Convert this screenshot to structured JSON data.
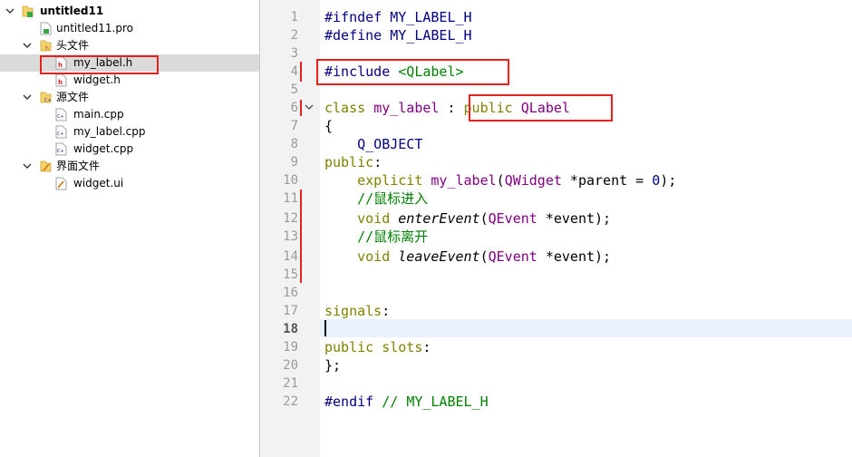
{
  "tree": {
    "project": "untitled11",
    "items": [
      {
        "label": "untitled11.pro"
      },
      {
        "label": "头文件"
      },
      {
        "label": "my_label.h"
      },
      {
        "label": "widget.h"
      },
      {
        "label": "源文件"
      },
      {
        "label": "main.cpp"
      },
      {
        "label": "my_label.cpp"
      },
      {
        "label": "widget.cpp"
      },
      {
        "label": "界面文件"
      },
      {
        "label": "widget.ui"
      }
    ]
  },
  "editor": {
    "current_line": "18",
    "line_numbers": [
      "1",
      "2",
      "3",
      "4",
      "5",
      "6",
      "7",
      "8",
      "9",
      "10",
      "11",
      "12",
      "13",
      "14",
      "15",
      "16",
      "17",
      "18",
      "19",
      "20",
      "21",
      "22"
    ],
    "code": {
      "l1a": "#ifndef",
      "l1b": " MY_LABEL_H",
      "l2a": "#define",
      "l2b": " MY_LABEL_H",
      "l4a": "#include",
      "l4b": " <QLabel>",
      "l6a": "class",
      "l6b": " ",
      "l6c": "my_label",
      "l6d": " : ",
      "l6e": "public",
      "l6f": " ",
      "l6g": "QLabel",
      "l7": "{",
      "l8": "    Q_OBJECT",
      "l9a": "public",
      "l9b": ":",
      "l10a": "    explicit",
      "l10b": " ",
      "l10c": "my_label",
      "l10d": "(",
      "l10e": "QWidget",
      "l10f": " *parent = ",
      "l10g": "0",
      "l10h": ");",
      "l11": "    //鼠标进入",
      "l12a": "    void",
      "l12b": " ",
      "l12c": "enterEvent",
      "l12d": "(",
      "l12e": "QEvent",
      "l12f": " *event);",
      "l13": "    //鼠标离开",
      "l14a": "    void",
      "l14b": " ",
      "l14c": "leaveEvent",
      "l14d": "(",
      "l14e": "QEvent",
      "l14f": " *event);",
      "l17a": "signals",
      "l17b": ":",
      "l19a": "public",
      "l19b": " ",
      "l19c": "slots",
      "l19d": ":",
      "l20": "};",
      "l22a": "#endif",
      "l22b": " // ",
      "l22c": "MY_LABEL_H"
    }
  },
  "colors": {
    "highlight_red": "#e3211f",
    "keyword": "#808000",
    "type": "#800080",
    "string_comment": "#008000",
    "preprocessor": "#000080",
    "current_line_bg": "#e8f2fe"
  },
  "icons": [
    "chevron-down-icon",
    "chevron-right-icon",
    "project-icon",
    "pro-file-icon",
    "header-folder-icon",
    "header-file-icon",
    "source-folder-icon",
    "cpp-file-icon",
    "form-folder-icon",
    "ui-file-icon",
    "fold-arrow-icon"
  ]
}
